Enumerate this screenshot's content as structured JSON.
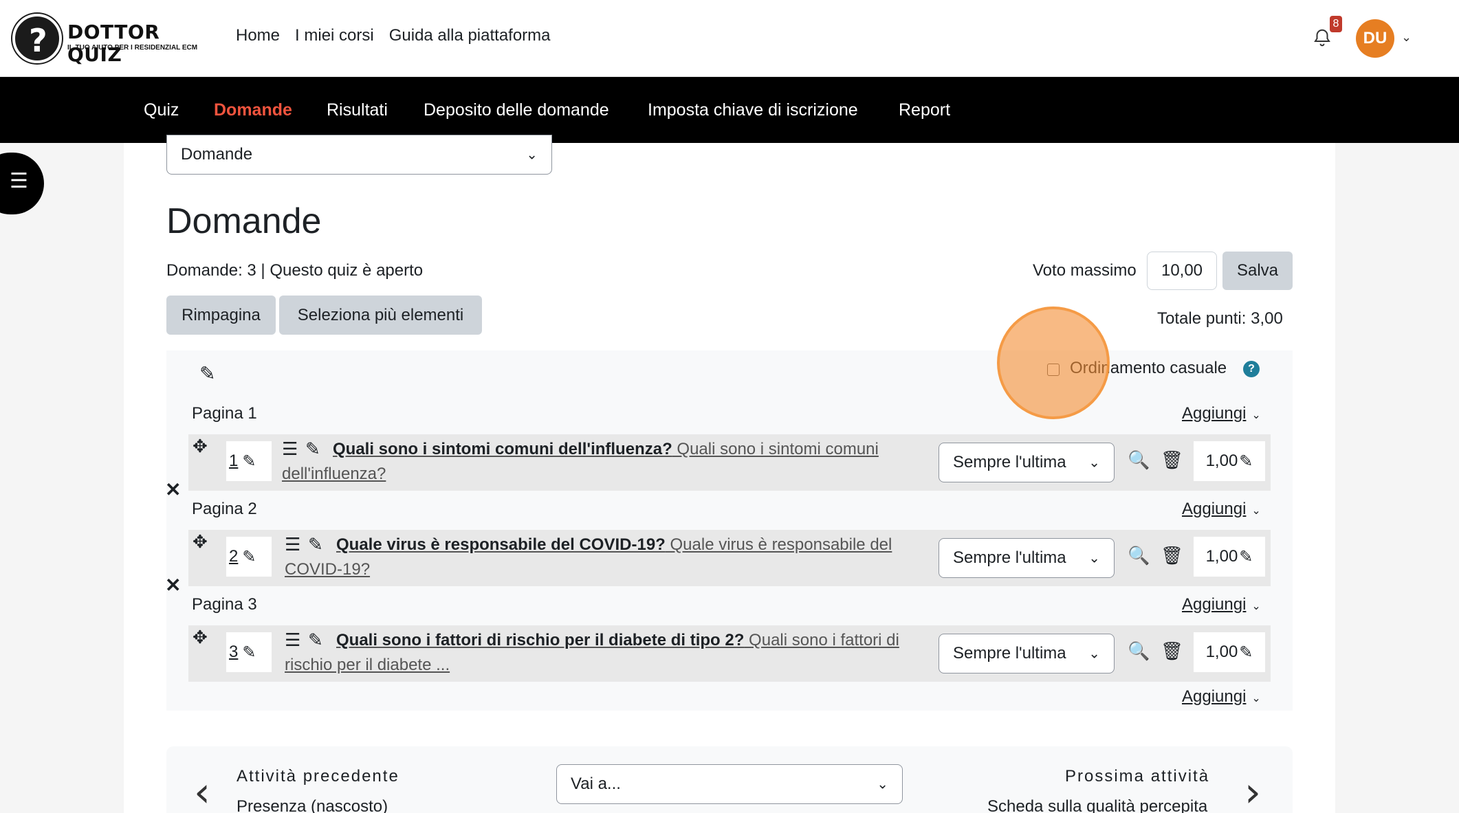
{
  "brand": {
    "title": "DOTTOR QUIZ",
    "subtitle": "IL TUO AIUTO PER I RESIDENZIAL ECM"
  },
  "main_nav": [
    "Home",
    "I miei corsi",
    "Guida alla piattaforma"
  ],
  "notifications": {
    "count": "8"
  },
  "user": {
    "initials": "DU"
  },
  "secondary_nav": {
    "tabs": [
      "Quiz",
      "Domande",
      "Risultati",
      "Deposito delle domande",
      "Imposta chiave di iscrizione",
      "Report"
    ],
    "active": "Domande"
  },
  "page_select": {
    "value": "Domande"
  },
  "page": {
    "title": "Domande",
    "info": "Domande: 3 | Questo quiz è aperto",
    "voto_massimo_label": "Voto massimo",
    "voto_massimo_value": "10,00",
    "salva_label": "Salva",
    "rimpagina_label": "Rimpagina",
    "seleziona_label": "Seleziona più elementi",
    "totale_punti": "Totale punti: 3,00",
    "shuffle_label": "Ordinamento casuale",
    "aggiungi_label": "Aggiungi"
  },
  "pages": [
    {
      "label": "Pagina 1",
      "number": "1",
      "question_bold": "Quali sono i sintomi comuni dell'influenza?",
      "question_text": " Quali sono i sintomi comuni",
      "question_text2": "dell'influenza?",
      "behaviour": "Sempre l'ultima",
      "mark": "1,00"
    },
    {
      "label": "Pagina 2",
      "number": "2",
      "question_bold": "Quale virus è responsabile del COVID-19?",
      "question_text": " Quale virus è responsabile del",
      "question_text2": "COVID-19?",
      "behaviour": "Sempre l'ultima",
      "mark": "1,00"
    },
    {
      "label": "Pagina 3",
      "number": "3",
      "question_bold": "Quali sono i fattori di rischio per il diabete di tipo 2?",
      "question_text": " Quali sono i fattori di",
      "question_text2": "rischio per il diabete ...",
      "behaviour": "Sempre l'ultima",
      "mark": "1,00"
    }
  ],
  "activity_nav": {
    "prev_label": "Attività precedente",
    "prev_link": "Presenza (nascosto)",
    "jump_placeholder": "Vai a...",
    "next_label": "Prossima attività",
    "next_link": "Scheda sulla qualità percepita"
  },
  "colors": {
    "accent": "#f0543e",
    "highlight": "#f48c32",
    "help": "#1f7e9a"
  }
}
